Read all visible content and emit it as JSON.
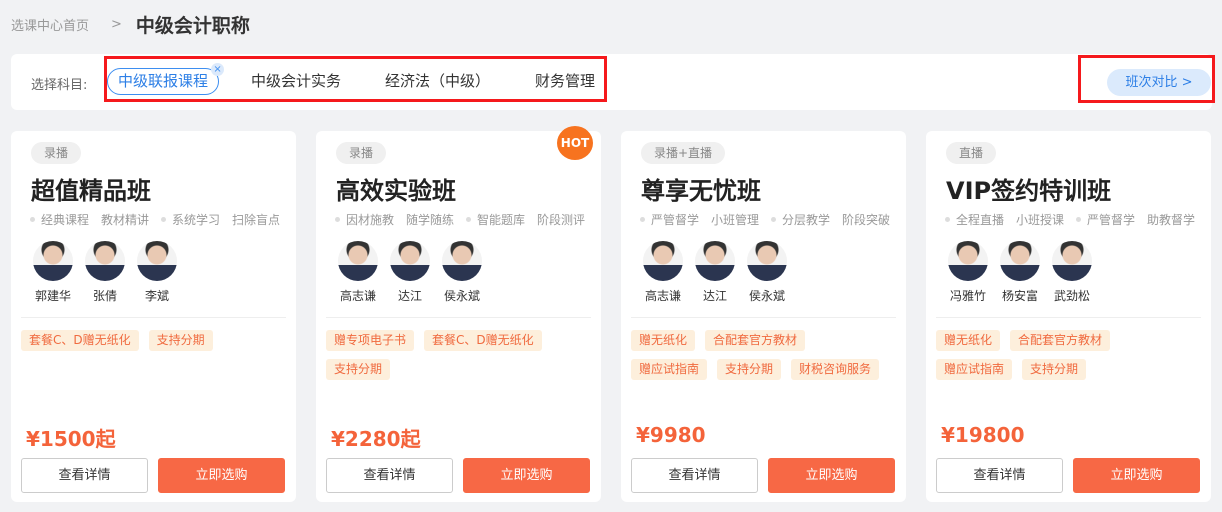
{
  "breadcrumb": {
    "home": "选课中心首页",
    "sep": ">",
    "current": "中级会计职称"
  },
  "filter": {
    "label": "选择科目:",
    "subjects": [
      "中级联报课程",
      "中级会计实务",
      "经济法（中级）",
      "财务管理"
    ],
    "close": "×",
    "compare": "班次对比 >"
  },
  "cards": [
    {
      "badge": "录播",
      "hot": "",
      "title": "超值精品班",
      "features": [
        "经典课程",
        "教材精讲",
        "系统学习",
        "扫除盲点"
      ],
      "teachers": [
        "郭建华",
        "张倩",
        "李斌"
      ],
      "tags": [
        "套餐C、D赠无纸化",
        "支持分期"
      ],
      "price": "¥1500起",
      "detail": "查看详情",
      "buy": "立即选购"
    },
    {
      "badge": "录播",
      "hot": "HOT",
      "title": "高效实验班",
      "features": [
        "因材施教",
        "随学随练",
        "智能题库",
        "阶段测评"
      ],
      "teachers": [
        "高志谦",
        "达江",
        "侯永斌"
      ],
      "tags": [
        "赠专项电子书",
        "套餐C、D赠无纸化",
        "支持分期"
      ],
      "price": "¥2280起",
      "detail": "查看详情",
      "buy": "立即选购"
    },
    {
      "badge": "录播+直播",
      "hot": "",
      "title": "尊享无忧班",
      "features": [
        "严管督学",
        "小班管理",
        "分层教学",
        "阶段突破"
      ],
      "teachers": [
        "高志谦",
        "达江",
        "侯永斌"
      ],
      "tags": [
        "赠无纸化",
        "合配套官方教材",
        "赠应试指南",
        "支持分期",
        "财税咨询服务"
      ],
      "price": "¥9980",
      "detail": "查看详情",
      "buy": "立即选购"
    },
    {
      "badge": "直播",
      "hot": "",
      "title": "VIP签约特训班",
      "features": [
        "全程直播",
        "小班授课",
        "严管督学",
        "助教督学"
      ],
      "teachers": [
        "冯雅竹",
        "杨安富",
        "武劲松"
      ],
      "tags": [
        "赠无纸化",
        "合配套官方教材",
        "赠应试指南",
        "支持分期"
      ],
      "price": "¥19800",
      "detail": "查看详情",
      "buy": "立即选购"
    }
  ],
  "colors": {
    "accent": "#f76845",
    "blue": "#2d7fe6",
    "annotation": "#f5191c"
  }
}
